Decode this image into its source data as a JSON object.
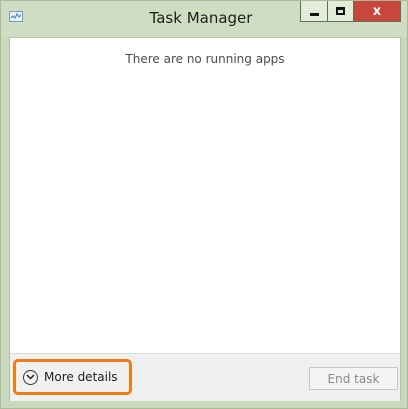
{
  "window": {
    "title": "Task Manager",
    "icon": "task-manager-icon",
    "controls": {
      "minimize": "minimize-icon",
      "maximize": "maximize-icon",
      "close_label": "x"
    }
  },
  "main": {
    "empty_message": "There are no running apps"
  },
  "footer": {
    "more_details_label": "More details",
    "more_details_icon": "chevron-down-circle-icon",
    "end_task_label": "End task",
    "highlight_color": "#f07c14"
  }
}
